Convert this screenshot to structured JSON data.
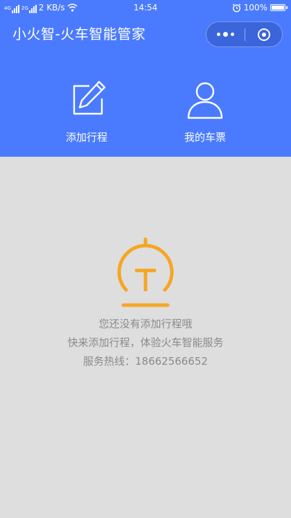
{
  "status_bar": {
    "signal_1": "4G",
    "signal_2": "2G",
    "net_speed": "2 KB/s",
    "time": "14:54",
    "battery": "100%",
    "battery_level": 1.0,
    "icons": [
      "signal-icon",
      "wifi-icon",
      "alarm-icon",
      "battery-icon"
    ]
  },
  "header": {
    "title": "小火智-火车智能管家",
    "background": "#4a7bff",
    "capsule": {
      "more_icon": "more-dots-icon",
      "close_icon": "close-target-icon"
    }
  },
  "actions": [
    {
      "label": "添加行程",
      "icon": "edit-icon"
    },
    {
      "label": "我的车票",
      "icon": "user-icon"
    }
  ],
  "empty_state": {
    "icon": "railway-icon",
    "icon_color": "#f5a623",
    "line_1": "您还没有添加行程哦",
    "line_2": "快来添加行程，体验火车智能服务",
    "line_3": "服务热线：18662566652"
  },
  "colors": {
    "page_background": "#dedede",
    "text_muted": "#8a8a8a"
  }
}
